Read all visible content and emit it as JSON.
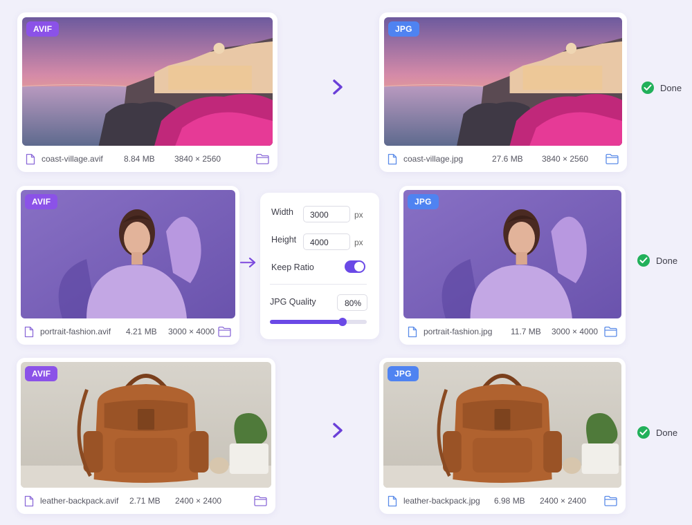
{
  "rows": [
    {
      "source": {
        "format": "AVIF",
        "filename": "coast-village.avif",
        "size": "8.84 MB",
        "dimensions": "3840 × 2560"
      },
      "output": {
        "format": "JPG",
        "filename": "coast-village.jpg",
        "size": "27.6 MB",
        "dimensions": "3840 × 2560"
      },
      "status": "Done"
    },
    {
      "source": {
        "format": "AVIF",
        "filename": "portrait-fashion.avif",
        "size": "4.21 MB",
        "dimensions": "3000 × 4000"
      },
      "output": {
        "format": "JPG",
        "filename": "portrait-fashion.jpg",
        "size": "11.7 MB",
        "dimensions": "3000 × 4000"
      },
      "status": "Done"
    },
    {
      "source": {
        "format": "AVIF",
        "filename": "leather-backpack.avif",
        "size": "2.71 MB",
        "dimensions": "2400 × 2400"
      },
      "output": {
        "format": "JPG",
        "filename": "leather-backpack.jpg",
        "size": "6.98 MB",
        "dimensions": "2400 × 2400"
      },
      "status": "Done"
    }
  ],
  "settings": {
    "width_label": "Width",
    "width_value": "3000",
    "width_unit": "px",
    "height_label": "Height",
    "height_value": "4000",
    "height_unit": "px",
    "keep_ratio_label": "Keep Ratio",
    "keep_ratio_on": true,
    "quality_label": "JPG Quality",
    "quality_value": "80%",
    "quality_level": 0.75
  },
  "colors": {
    "accent": "#6a49e6",
    "avif_badge": "#8b52e8",
    "jpg_badge": "#4f83f1",
    "success": "#22b05a"
  },
  "icons": [
    "file-icon",
    "folder-icon",
    "arrow-right-icon",
    "check-circle-icon"
  ]
}
